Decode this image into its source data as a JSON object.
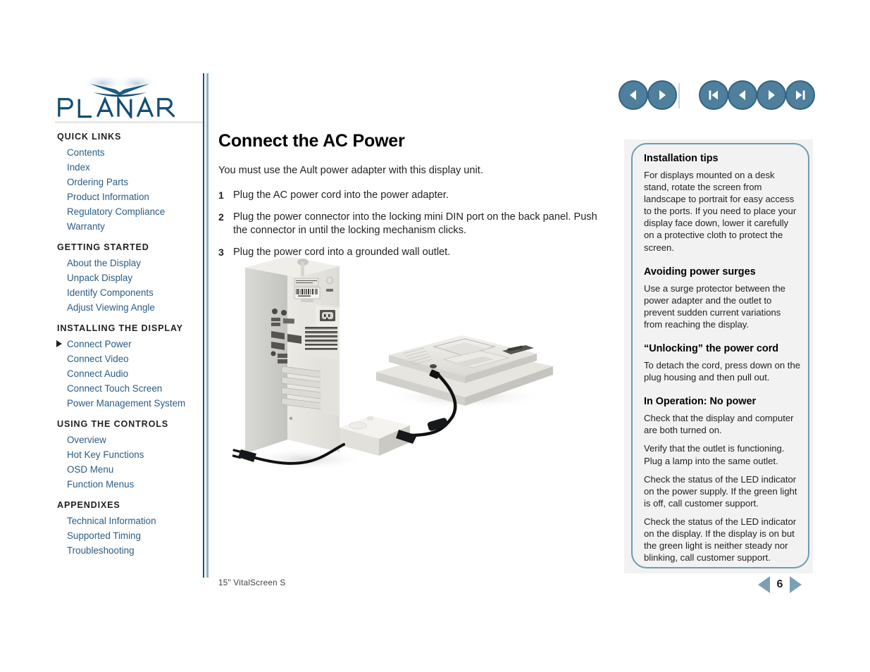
{
  "brand": {
    "name": "PLANAR",
    "logo_color": "#154c72",
    "swoosh_color": "#1d5b82"
  },
  "topnav": {
    "buttons": [
      {
        "name": "back-arrow",
        "glyph": "triangle-left"
      },
      {
        "name": "forward-arrow",
        "glyph": "triangle-right"
      },
      {
        "name": "first-page",
        "glyph": "skip-back"
      },
      {
        "name": "previous-page",
        "glyph": "triangle-left"
      },
      {
        "name": "next-page",
        "glyph": "triangle-right"
      },
      {
        "name": "last-page",
        "glyph": "skip-forward"
      }
    ],
    "button_fill": "#4e7f9c",
    "button_border": "#35647f"
  },
  "sidebar": {
    "groups": [
      {
        "heading": "QUICK LINKS",
        "items": [
          {
            "label": "Contents",
            "active": false
          },
          {
            "label": "Index",
            "active": false
          },
          {
            "label": "Ordering Parts",
            "active": false
          },
          {
            "label": "Product Information",
            "active": false
          },
          {
            "label": "Regulatory Compliance",
            "active": false
          },
          {
            "label": "Warranty",
            "active": false
          }
        ]
      },
      {
        "heading": "GETTING STARTED",
        "items": [
          {
            "label": "About the Display",
            "active": false
          },
          {
            "label": "Unpack Display",
            "active": false
          },
          {
            "label": "Identify Components",
            "active": false
          },
          {
            "label": "Adjust Viewing Angle",
            "active": false
          }
        ]
      },
      {
        "heading": "INSTALLING THE DISPLAY",
        "items": [
          {
            "label": "Connect Power",
            "active": true
          },
          {
            "label": "Connect Video",
            "active": false
          },
          {
            "label": "Connect Audio",
            "active": false
          },
          {
            "label": "Connect Touch Screen",
            "active": false
          },
          {
            "label": "Power Management System",
            "active": false
          }
        ]
      },
      {
        "heading": "USING THE CONTROLS",
        "items": [
          {
            "label": "Overview",
            "active": false
          },
          {
            "label": "Hot Key Functions",
            "active": false
          },
          {
            "label": "OSD Menu",
            "active": false
          },
          {
            "label": "Function Menus",
            "active": false
          }
        ]
      },
      {
        "heading": "APPENDIXES",
        "items": [
          {
            "label": "Technical Information",
            "active": false
          },
          {
            "label": "Supported Timing",
            "active": false
          },
          {
            "label": "Troubleshooting",
            "active": false
          }
        ]
      }
    ],
    "link_color": "#2a5d84"
  },
  "main": {
    "title": "Connect the AC Power",
    "intro": "You must use the Ault power adapter with this display unit.",
    "steps": [
      {
        "num": "1",
        "text": "Plug the AC power cord into the power adapter."
      },
      {
        "num": "2",
        "text": "Plug the power connector into the locking mini DIN port on the back panel. Push the connector in until the locking mechanism clicks."
      },
      {
        "num": "3",
        "text": "Plug the power cord into a grounded wall outlet."
      }
    ],
    "figure_caption": ""
  },
  "tips": {
    "sections": [
      {
        "heading": "Installation tips",
        "paragraphs": [
          "For displays mounted on a desk stand, rotate the screen from landscape to portrait for easy access to the ports. If you need to place your display face down, lower it carefully on a protective cloth to protect the screen."
        ]
      },
      {
        "heading": "Avoiding power surges",
        "paragraphs": [
          "Use a surge protector between the power adapter and the outlet to prevent sudden current variations from reaching the display."
        ]
      },
      {
        "heading": "“Unlocking” the power cord",
        "paragraphs": [
          "To detach the cord, press down on the plug housing and then pull out."
        ]
      },
      {
        "heading": "In Operation: No power",
        "paragraphs": [
          "Check that the display and computer are both turned on.",
          "Verify that the outlet is functioning. Plug a lamp into the same outlet.",
          "Check the status of the LED indicator on the power supply.  If the green light is off, call customer support.",
          "Check the status of the LED indicator on the display. If the display is on but the green light is neither steady nor blinking, call customer support."
        ]
      }
    ],
    "border_color": "#6e9cb5",
    "backdrop_color": "#f2f2f2"
  },
  "footer": {
    "product": "15\" VitalScreen S",
    "page_number": "6",
    "prev_label": "previous page",
    "next_label": "next page",
    "arrow_color": "#7ba0b6"
  }
}
